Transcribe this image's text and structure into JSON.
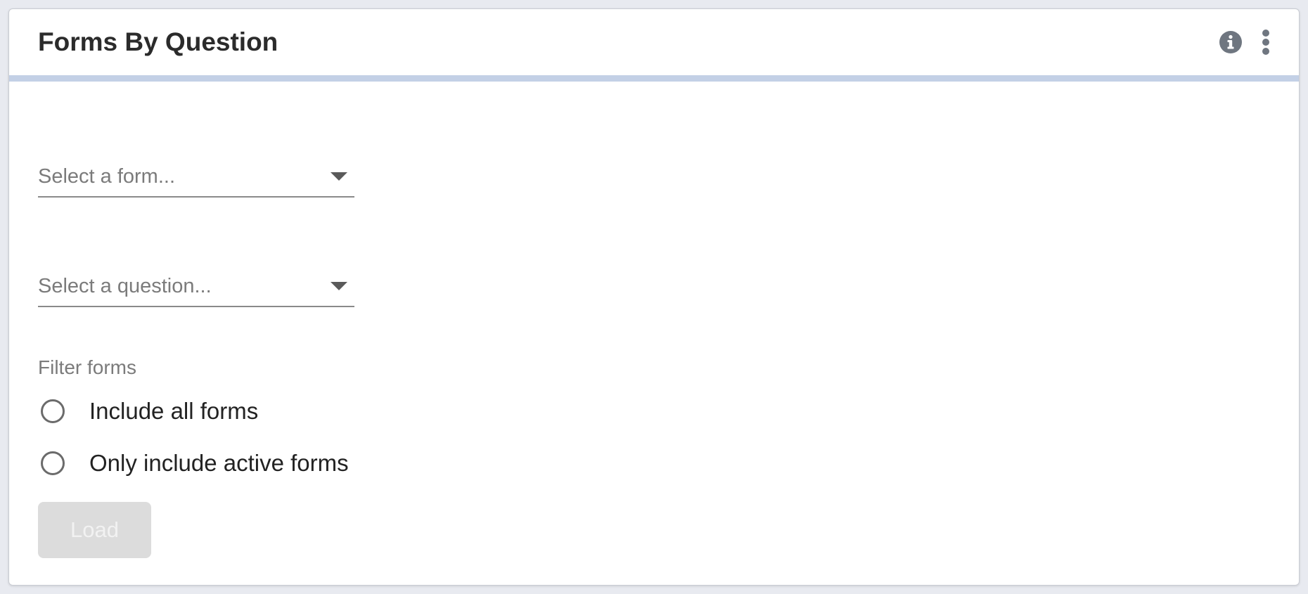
{
  "widget": {
    "title": "Forms By Question",
    "actions": {
      "info_icon": "info-circle-icon",
      "menu_icon": "more-vertical-icon"
    },
    "accent_bar_color": "#c3d0e6"
  },
  "form_select": {
    "placeholder": "Select a form...",
    "selected_value": ""
  },
  "question_select": {
    "placeholder": "Select a question...",
    "selected_value": ""
  },
  "filter": {
    "label": "Filter forms",
    "options": [
      {
        "label": "Include all forms",
        "checked": false
      },
      {
        "label": "Only include active forms",
        "checked": false
      }
    ]
  },
  "load_button": {
    "label": "Load",
    "disabled": true
  }
}
